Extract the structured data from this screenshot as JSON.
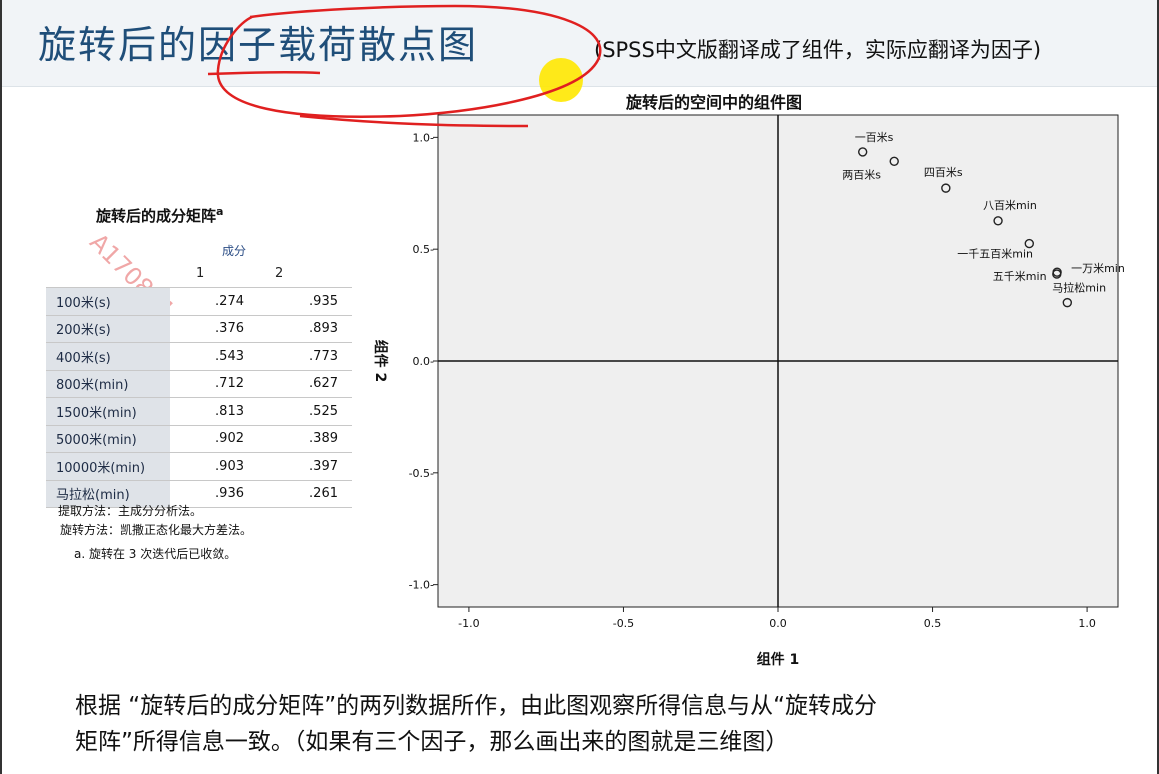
{
  "header": {
    "title": "旋转后的因子载荷散点图",
    "note": "(SPSS中文版翻译成了组件，实际应翻译为因子)"
  },
  "matrix": {
    "title": "旋转后的成分矩阵",
    "superscript": "a",
    "component_header": "成分",
    "columns": [
      "1",
      "2"
    ],
    "rows": [
      {
        "label": "100米(s)",
        "c1": ".274",
        "c2": ".935"
      },
      {
        "label": "200米(s)",
        "c1": ".376",
        "c2": ".893"
      },
      {
        "label": "400米(s)",
        "c1": ".543",
        "c2": ".773"
      },
      {
        "label": "800米(min)",
        "c1": ".712",
        "c2": ".627"
      },
      {
        "label": "1500米(min)",
        "c1": ".813",
        "c2": ".525"
      },
      {
        "label": "5000米(min)",
        "c1": ".902",
        "c2": ".389"
      },
      {
        "label": "10000米(min)",
        "c1": ".903",
        "c2": ".397"
      },
      {
        "label": "马拉松(min)",
        "c1": ".936",
        "c2": ".261"
      }
    ],
    "notes": [
      "提取方法：主成分分析法。",
      "旋转方法：凯撒正态化最大方差法。",
      "a. 旋转在 3 次迭代后已收敛。"
    ]
  },
  "watermark": "A170841",
  "chart_data": {
    "type": "scatter",
    "title": "旋转后的空间中的组件图",
    "xlabel": "组件 1",
    "ylabel": "组件 2",
    "xlim": [
      -1.1,
      1.1
    ],
    "ylim": [
      -1.1,
      1.1
    ],
    "xticks": [
      -1.0,
      -0.5,
      0.0,
      0.5,
      1.0
    ],
    "yticks": [
      -1.0,
      -0.5,
      0.0,
      0.5,
      1.0
    ],
    "xtick_labels": [
      "-1.0",
      "-0.5",
      "0.0",
      "0.5",
      "1.0"
    ],
    "ytick_labels": [
      "-1.0-",
      "-0.5-",
      "0.0-",
      "0.5-",
      "1.0-"
    ],
    "grid": false,
    "points": [
      {
        "label": "一百米s",
        "x": 0.274,
        "y": 0.935
      },
      {
        "label": "两百米s",
        "x": 0.376,
        "y": 0.893
      },
      {
        "label": "四百米s",
        "x": 0.543,
        "y": 0.773
      },
      {
        "label": "八百米min",
        "x": 0.712,
        "y": 0.627
      },
      {
        "label": "一千五百米min",
        "x": 0.813,
        "y": 0.525
      },
      {
        "label": "五千米min",
        "x": 0.902,
        "y": 0.389
      },
      {
        "label": "一万米min",
        "x": 0.903,
        "y": 0.397
      },
      {
        "label": "马拉松min",
        "x": 0.936,
        "y": 0.261
      }
    ]
  },
  "footer": {
    "line1": "根据 “旋转后的成分矩阵”的两列数据所作，由此图观察所得信息与从“旋转成分",
    "line2": "矩阵”所得信息一致。（如果有三个因子，那么画出来的图就是三维图）"
  },
  "colors": {
    "annotation": "#e02020",
    "highlight": "#ffe800",
    "title": "#1f4e79",
    "plot_bg": "#efefef"
  }
}
